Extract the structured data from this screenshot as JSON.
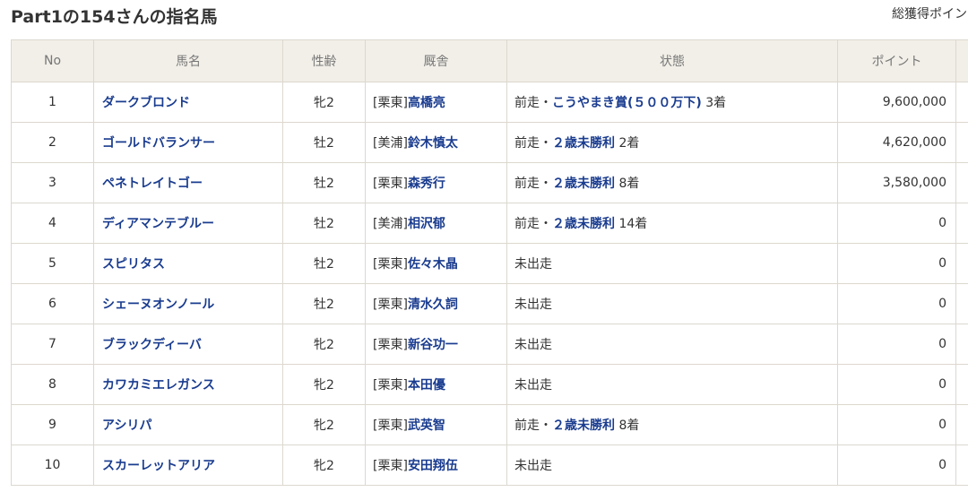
{
  "header": {
    "title": "Part1の154さんの指名馬",
    "total_label": "総獲得ポイン"
  },
  "table": {
    "columns": [
      "No",
      "馬名",
      "性齢",
      "厩舎",
      "状態",
      "ポイント"
    ],
    "rows": [
      {
        "no": "1",
        "horse": "ダークブロンド",
        "sex_age": "牝2",
        "region": "[栗東]",
        "trainer": "高橋亮",
        "status_prefix": "前走・",
        "race": "こうやまき賞(５００万下)",
        "place": "3着",
        "points": "9,600,000"
      },
      {
        "no": "2",
        "horse": "ゴールドバランサー",
        "sex_age": "牡2",
        "region": "[美浦]",
        "trainer": "鈴木慎太",
        "status_prefix": "前走・",
        "race": "２歳未勝利",
        "place": "2着",
        "points": "4,620,000"
      },
      {
        "no": "3",
        "horse": "ペネトレイトゴー",
        "sex_age": "牡2",
        "region": "[栗東]",
        "trainer": "森秀行",
        "status_prefix": "前走・",
        "race": "２歳未勝利",
        "place": "8着",
        "points": "3,580,000"
      },
      {
        "no": "4",
        "horse": "ディアマンテブルー",
        "sex_age": "牡2",
        "region": "[美浦]",
        "trainer": "相沢郁",
        "status_prefix": "前走・",
        "race": "２歳未勝利",
        "place": "14着",
        "points": "0"
      },
      {
        "no": "5",
        "horse": "スピリタス",
        "sex_age": "牡2",
        "region": "[栗東]",
        "trainer": "佐々木晶",
        "status_prefix": "未出走",
        "race": "",
        "place": "",
        "points": "0"
      },
      {
        "no": "6",
        "horse": "シェーヌオンノール",
        "sex_age": "牡2",
        "region": "[栗東]",
        "trainer": "清水久詞",
        "status_prefix": "未出走",
        "race": "",
        "place": "",
        "points": "0"
      },
      {
        "no": "7",
        "horse": "ブラックディーバ",
        "sex_age": "牝2",
        "region": "[栗東]",
        "trainer": "新谷功一",
        "status_prefix": "未出走",
        "race": "",
        "place": "",
        "points": "0"
      },
      {
        "no": "8",
        "horse": "カワカミエレガンス",
        "sex_age": "牝2",
        "region": "[栗東]",
        "trainer": "本田優",
        "status_prefix": "未出走",
        "race": "",
        "place": "",
        "points": "0"
      },
      {
        "no": "9",
        "horse": "アシリパ",
        "sex_age": "牝2",
        "region": "[栗東]",
        "trainer": "武英智",
        "status_prefix": "前走・",
        "race": "２歳未勝利",
        "place": "8着",
        "points": "0"
      },
      {
        "no": "10",
        "horse": "スカーレットアリア",
        "sex_age": "牝2",
        "region": "[栗東]",
        "trainer": "安田翔伍",
        "status_prefix": "未出走",
        "race": "",
        "place": "",
        "points": "0"
      }
    ]
  },
  "colors": {
    "header_bg": "#f2efe8",
    "link": "#1a3c8f",
    "border": "#dcd8cf"
  }
}
